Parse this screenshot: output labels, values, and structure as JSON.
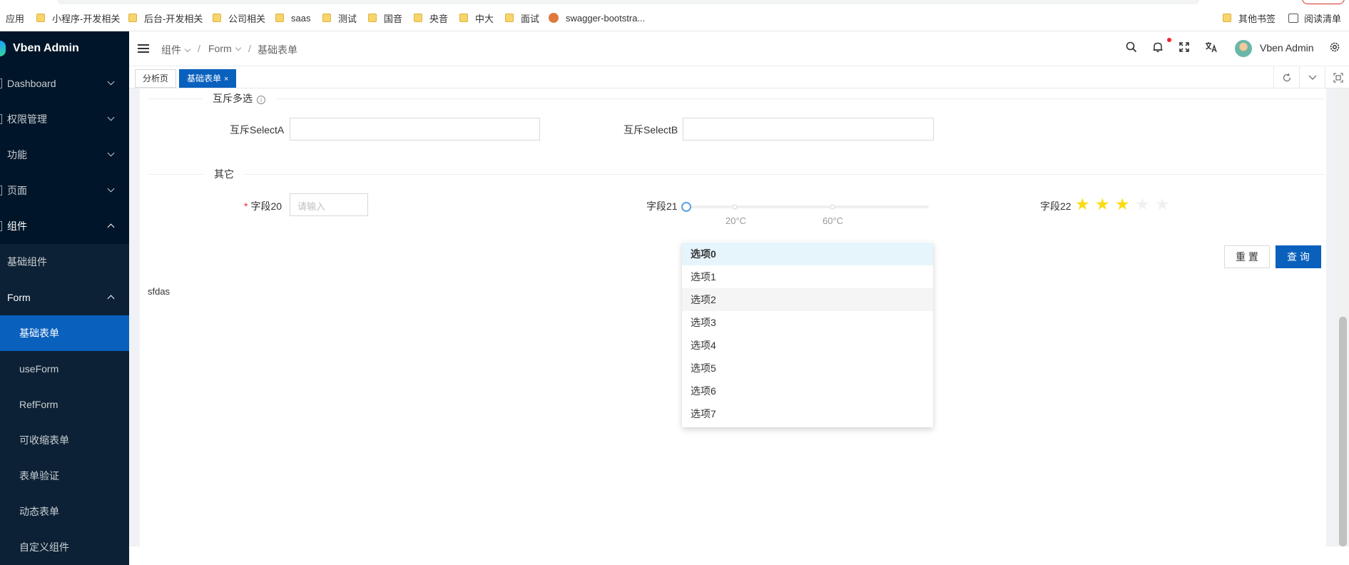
{
  "bookmarks": {
    "apps_label": "应用",
    "items": [
      "小程序-开发相关",
      "后台-开发相关",
      "公司相关",
      "saas",
      "测试",
      "国音",
      "央音",
      "中大",
      "面试",
      "swagger-bootstra..."
    ],
    "other_bookmarks": "其他书签",
    "reading_list": "阅读清单"
  },
  "sidebar": {
    "app_title": "Vben Admin",
    "items": [
      {
        "label": "Dashboard"
      },
      {
        "label": "权限管理"
      },
      {
        "label": "功能"
      },
      {
        "label": "页面"
      },
      {
        "label": "组件"
      },
      {
        "label": "基础组件"
      },
      {
        "label": "Form"
      },
      {
        "label": "基础表单"
      },
      {
        "label": "useForm"
      },
      {
        "label": "RefForm"
      },
      {
        "label": "可收缩表单"
      },
      {
        "label": "表单验证"
      },
      {
        "label": "动态表单"
      },
      {
        "label": "自定义组件"
      }
    ]
  },
  "header": {
    "breadcrumb": [
      "组件",
      "Form",
      "基础表单"
    ],
    "separator": "/",
    "username": "Vben Admin",
    "icons": [
      "menu-fold-icon",
      "search-icon",
      "bell-icon",
      "fullscreen-icon",
      "translate-icon",
      "settings-icon"
    ]
  },
  "tabs": {
    "items": [
      "分析页",
      "基础表单"
    ],
    "close": "×"
  },
  "form": {
    "section_mutex": "互斥多选",
    "select_a_label": "互斥SelectA",
    "select_b_label": "互斥SelectB",
    "section_other": "其它",
    "field20_label": "字段20",
    "field20_placeholder": "请输入",
    "field21_label": "字段21",
    "slider_marks": [
      "20°C",
      "60°C"
    ],
    "field22_label": "字段22",
    "rating_value": 3,
    "rating_max": 5,
    "reset_label": "重 置",
    "search_label": "查 询",
    "footer_text": "sfdas"
  },
  "dropdown": {
    "options": [
      "选项0",
      "选项1",
      "选项2",
      "选项3",
      "选项4",
      "选项5",
      "选项6",
      "选项7"
    ],
    "selected_index": 0,
    "hover_index": 2
  },
  "colors": {
    "sidebar_bg": "#001529",
    "primary": "#0960bd",
    "star": "#fadb14",
    "star_empty": "#f0f0f0"
  }
}
